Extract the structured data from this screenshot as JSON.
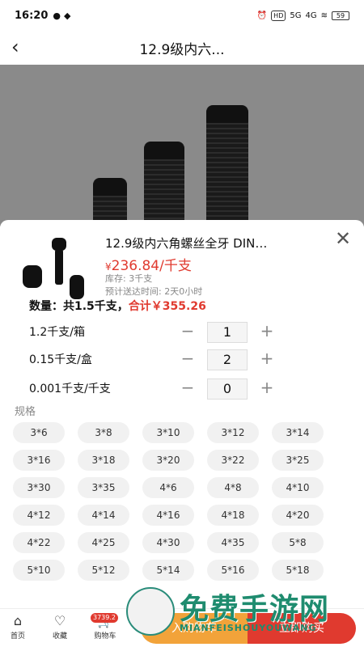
{
  "status_bar": {
    "time": "16:20",
    "hd_label": "HD",
    "network_label": "5G",
    "network2_label": "4G",
    "battery": "59"
  },
  "nav": {
    "title": "12.9级内六..."
  },
  "product": {
    "title": "12.9级内六角螺丝全牙 DIN…",
    "price_symbol": "¥",
    "price": "236.84",
    "price_unit": "/千支",
    "stock": "库存: 3千支",
    "eta": "预计送达时间:   2天0小时"
  },
  "summary": {
    "count_text": "数量：共1.5千支，",
    "total_text": "合计￥355.26"
  },
  "quantities": [
    {
      "label": "1.2千支/箱",
      "value": "1",
      "minus": "−",
      "plus": "+"
    },
    {
      "label": "0.15千支/盒",
      "value": "2",
      "minus": "−",
      "plus": "+"
    },
    {
      "label": "0.001千支/千支",
      "value": "0",
      "minus": "−",
      "plus": "+"
    }
  ],
  "spec": {
    "label": "规格",
    "options": [
      "3*6",
      "3*8",
      "3*10",
      "3*12",
      "3*14",
      "3*16",
      "3*18",
      "3*20",
      "3*22",
      "3*25",
      "3*30",
      "3*35",
      "4*6",
      "4*8",
      "4*10",
      "4*12",
      "4*14",
      "4*16",
      "4*18",
      "4*20",
      "4*22",
      "4*25",
      "4*30",
      "4*35",
      "5*8",
      "5*10",
      "5*12",
      "5*14",
      "5*16",
      "5*18"
    ]
  },
  "bottom_bar": {
    "home_label": "首页",
    "favorite_label": "收藏",
    "cart_label": "购物车",
    "cart_badge": "3739.2",
    "add_to_cart": "入购物车",
    "buy_now": "立即购买"
  },
  "watermark": {
    "text": "免费手游网",
    "sub": "MIANFEISHOUYOUWANG"
  },
  "colors": {
    "accent": "#e03a2f",
    "cart_button": "#f2a33a",
    "watermark": "#1f8c6f"
  }
}
